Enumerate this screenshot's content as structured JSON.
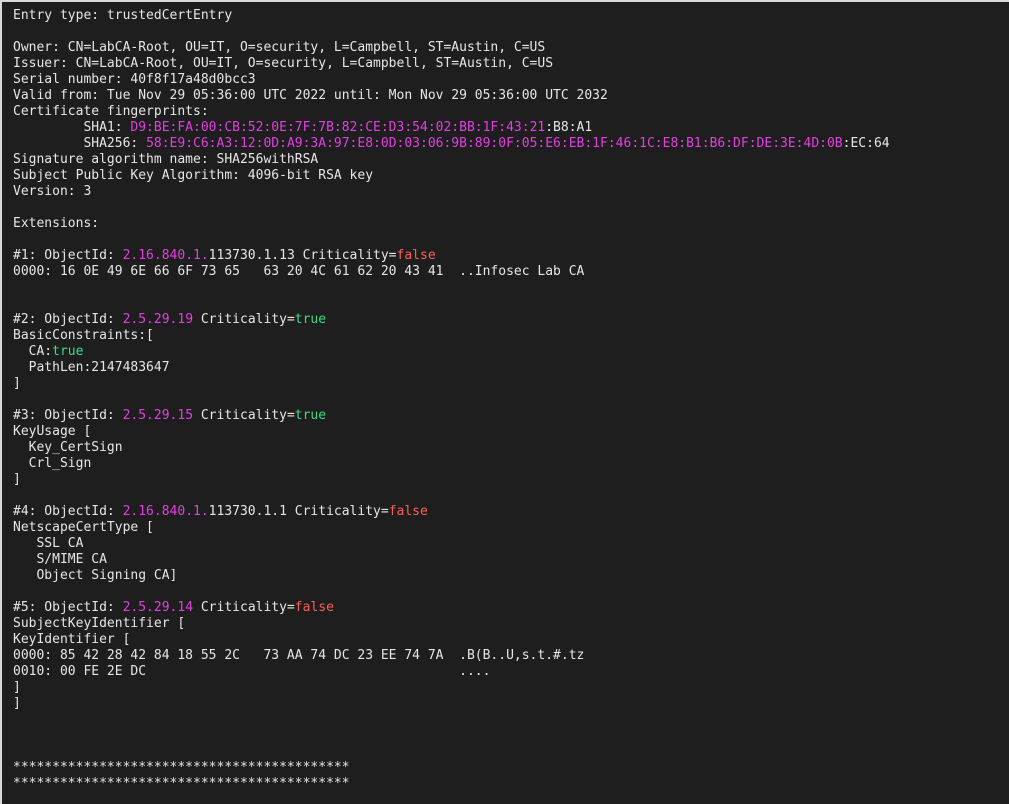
{
  "terminal": {
    "colors": {
      "background": "#1e1e1e",
      "foreground": "#e6e6e6",
      "magenta": "#e040e0",
      "red": "#ff5c5c",
      "green": "#3ddc84"
    },
    "lines": [
      [
        {
          "t": "Entry type: trustedCertEntry"
        }
      ],
      [],
      [
        {
          "t": "Owner: CN=LabCA-Root, OU=IT, O=security, L=Campbell, ST=Austin, C=US"
        }
      ],
      [
        {
          "t": "Issuer: CN=LabCA-Root, OU=IT, O=security, L=Campbell, ST=Austin, C=US"
        }
      ],
      [
        {
          "t": "Serial number: 40f8f17a48d0bcc3"
        }
      ],
      [
        {
          "t": "Valid from: Tue Nov 29 05:36:00 UTC 2022 until: Mon Nov 29 05:36:00 UTC 2032"
        }
      ],
      [
        {
          "t": "Certificate fingerprints:"
        }
      ],
      [
        {
          "t": "         SHA1: "
        },
        {
          "t": "D9:BE:FA:00:CB:52:0E:7F:7B:82:CE:D3:54:02:BB:1F:43:21",
          "c": "magenta"
        },
        {
          "t": ":B8:A1"
        }
      ],
      [
        {
          "t": "         SHA256: "
        },
        {
          "t": "58:E9:C6:A3:12:0D:A9:3A:97:E8:0D:03:06:9B:89:0F:05:E6:EB:1F:46:1C:E8:B1:B6:DF:DE:3E:4D:0B",
          "c": "magenta"
        },
        {
          "t": ":EC:64"
        }
      ],
      [
        {
          "t": "Signature algorithm name: SHA256withRSA"
        }
      ],
      [
        {
          "t": "Subject Public Key Algorithm: 4096-bit RSA key"
        }
      ],
      [
        {
          "t": "Version: 3"
        }
      ],
      [],
      [
        {
          "t": "Extensions:"
        }
      ],
      [],
      [
        {
          "t": "#1: ObjectId: "
        },
        {
          "t": "2.16.840.1.",
          "c": "magenta"
        },
        {
          "t": "113730.1.13 Criticality="
        },
        {
          "t": "false",
          "c": "red"
        }
      ],
      [
        {
          "t": "0000: 16 0E 49 6E 66 6F 73 65   63 20 4C 61 62 20 43 41  ..Infosec Lab CA"
        }
      ],
      [],
      [],
      [
        {
          "t": "#2: ObjectId: "
        },
        {
          "t": "2.5.29.19",
          "c": "magenta"
        },
        {
          "t": " Criticality="
        },
        {
          "t": "true",
          "c": "green"
        }
      ],
      [
        {
          "t": "BasicConstraints:["
        }
      ],
      [
        {
          "t": "  CA:"
        },
        {
          "t": "true",
          "c": "green"
        }
      ],
      [
        {
          "t": "  PathLen:2147483647"
        }
      ],
      [
        {
          "t": "]"
        }
      ],
      [],
      [
        {
          "t": "#3: ObjectId: "
        },
        {
          "t": "2.5.29.15",
          "c": "magenta"
        },
        {
          "t": " Criticality="
        },
        {
          "t": "true",
          "c": "green"
        }
      ],
      [
        {
          "t": "KeyUsage ["
        }
      ],
      [
        {
          "t": "  Key_CertSign"
        }
      ],
      [
        {
          "t": "  Crl_Sign"
        }
      ],
      [
        {
          "t": "]"
        }
      ],
      [],
      [
        {
          "t": "#4: ObjectId: "
        },
        {
          "t": "2.16.840.1.",
          "c": "magenta"
        },
        {
          "t": "113730.1.1 Criticality="
        },
        {
          "t": "false",
          "c": "red"
        }
      ],
      [
        {
          "t": "NetscapeCertType ["
        }
      ],
      [
        {
          "t": "   SSL CA"
        }
      ],
      [
        {
          "t": "   S/MIME CA"
        }
      ],
      [
        {
          "t": "   Object Signing CA]"
        }
      ],
      [],
      [
        {
          "t": "#5: ObjectId: "
        },
        {
          "t": "2.5.29.14",
          "c": "magenta"
        },
        {
          "t": " Criticality="
        },
        {
          "t": "false",
          "c": "red"
        }
      ],
      [
        {
          "t": "SubjectKeyIdentifier ["
        }
      ],
      [
        {
          "t": "KeyIdentifier ["
        }
      ],
      [
        {
          "t": "0000: 85 42 28 42 84 18 55 2C   73 AA 74 DC 23 EE 74 7A  .B(B..U,s.t.#.tz"
        }
      ],
      [
        {
          "t": "0010: 00 FE 2E DC                                        ...."
        }
      ],
      [
        {
          "t": "]"
        }
      ],
      [
        {
          "t": "]"
        }
      ],
      [],
      [],
      [],
      [
        {
          "t": "*******************************************"
        }
      ],
      [
        {
          "t": "*******************************************"
        }
      ]
    ]
  }
}
